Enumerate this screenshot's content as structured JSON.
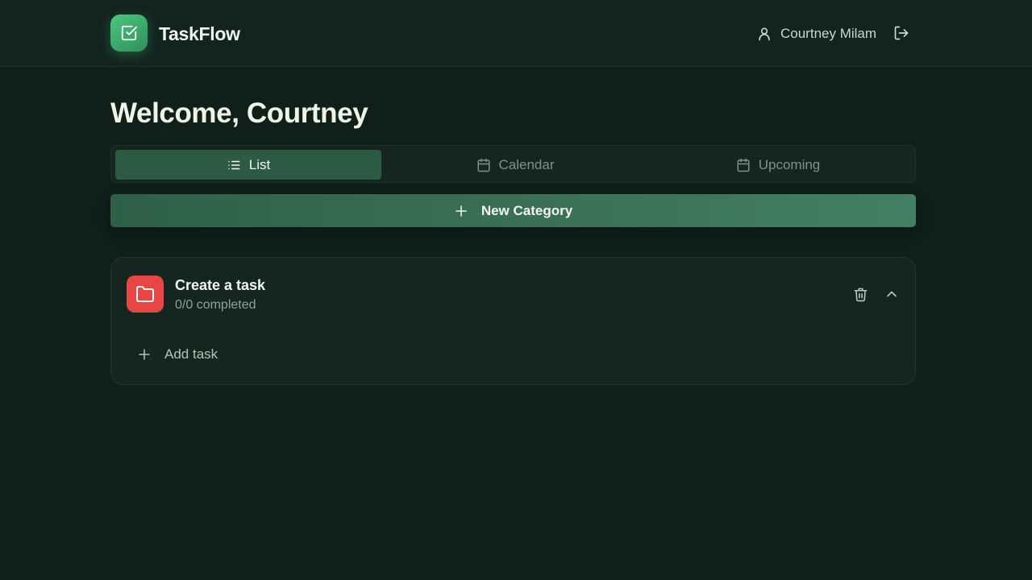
{
  "header": {
    "app_title": "TaskFlow",
    "logo_icon": "checkbox-icon",
    "user_name": "Courtney Milam",
    "user_icon": "user-icon",
    "logout_icon": "logout-icon"
  },
  "main": {
    "welcome": "Welcome, Courtney",
    "tabs": [
      {
        "label": "List",
        "icon": "list-icon",
        "active": true
      },
      {
        "label": "Calendar",
        "icon": "calendar-icon",
        "active": false
      },
      {
        "label": "Upcoming",
        "icon": "calendar-icon",
        "active": false
      }
    ],
    "new_category_label": "New Category",
    "categories": [
      {
        "title": "Create a task",
        "progress_text": "0/0 completed",
        "icon": "folder-icon",
        "color": "#e84545",
        "add_task_label": "Add task"
      }
    ]
  },
  "colors": {
    "background": "#101f1a",
    "accent": "#2c5a45",
    "brand": "#4cc77f",
    "category_red": "#e84545"
  }
}
